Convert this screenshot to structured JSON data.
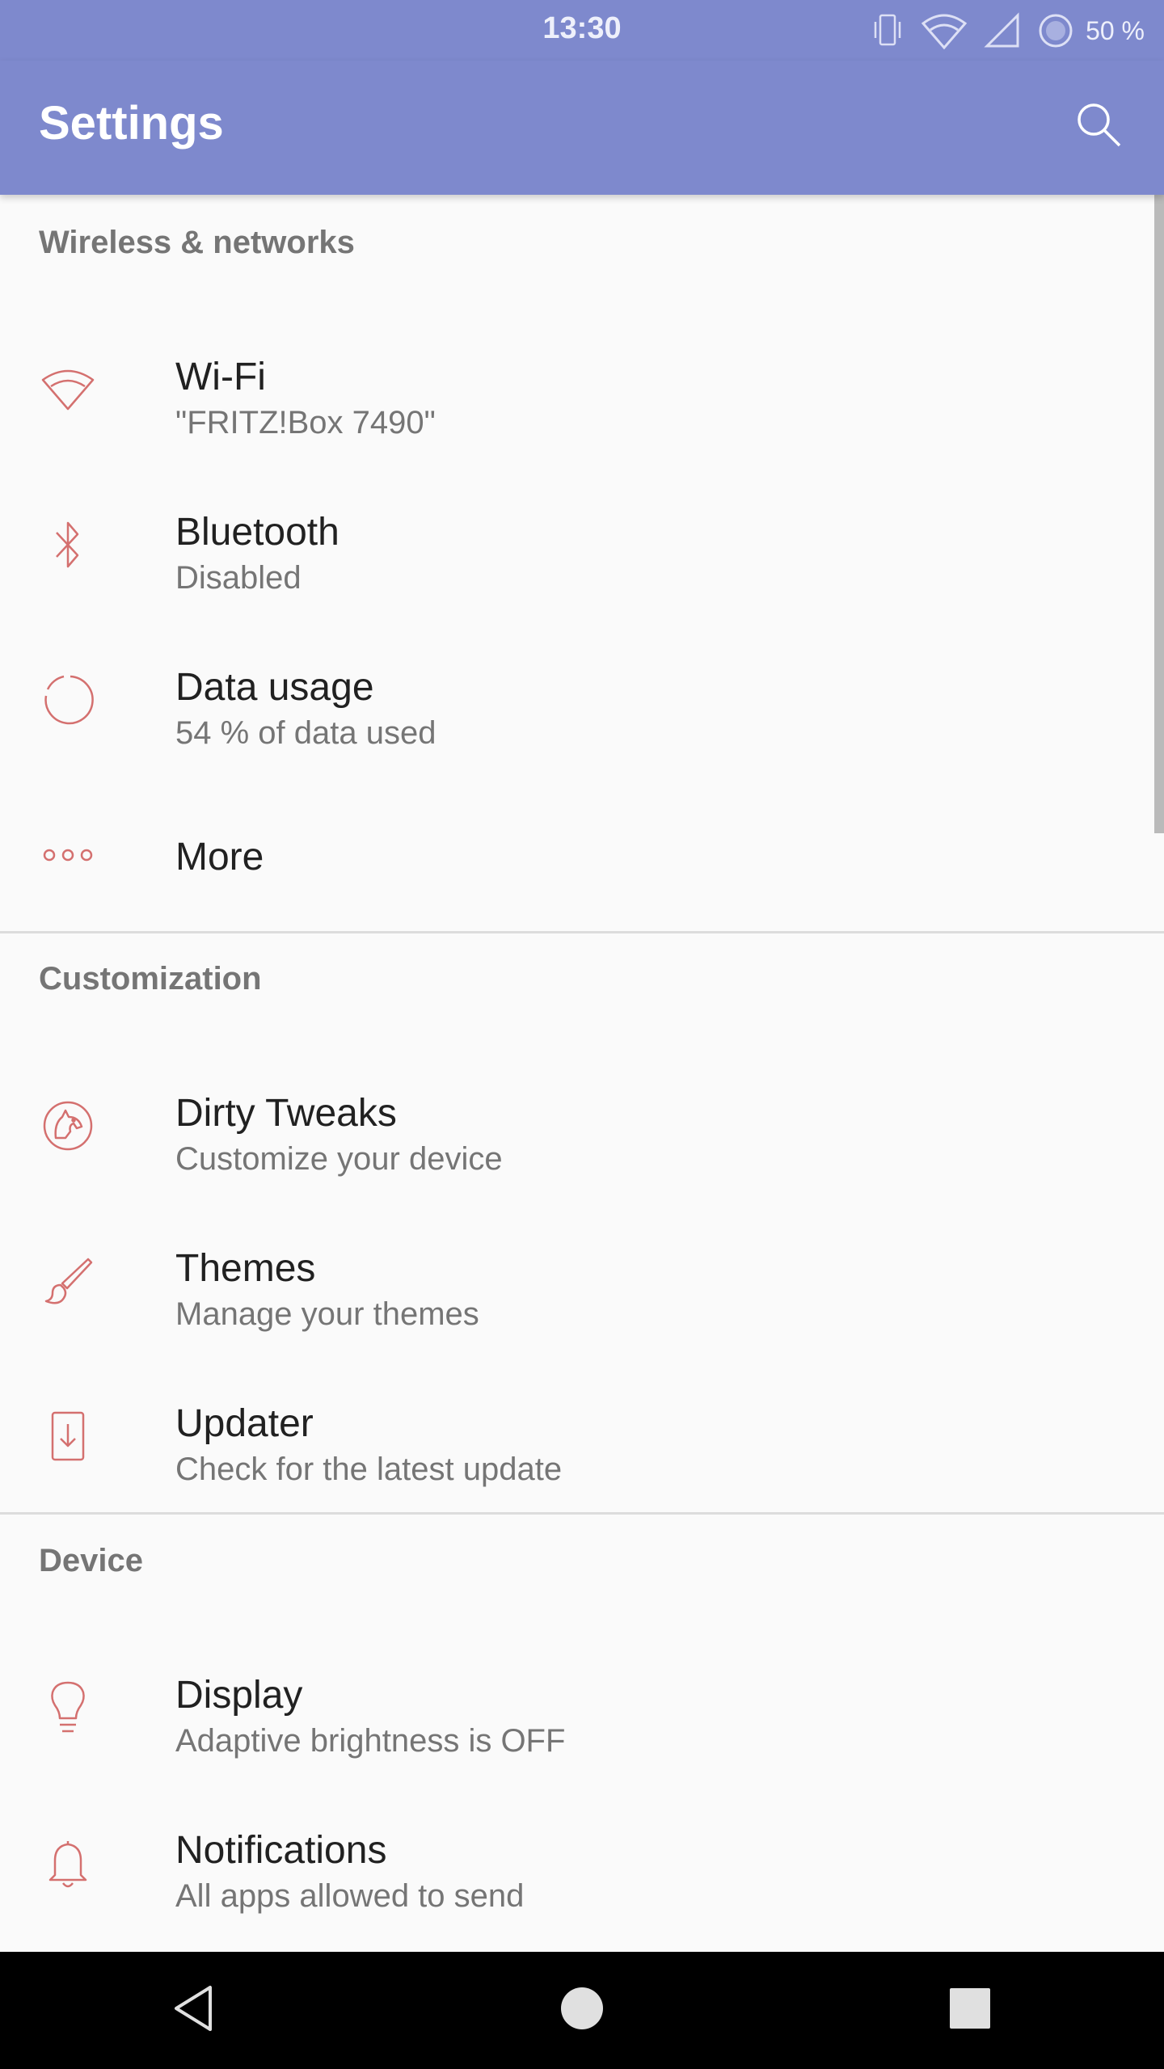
{
  "status_bar": {
    "time": "13:30",
    "battery_percent": "50 %",
    "icons": [
      "vibrate-icon",
      "wifi-icon",
      "cell-signal-icon",
      "battery-icon"
    ]
  },
  "app_bar": {
    "title": "Settings",
    "search_icon": "search-icon",
    "background_color": "#7e89cd"
  },
  "accent_color": "#d4706f",
  "sections": [
    {
      "header": "Wireless & networks",
      "items": [
        {
          "icon": "wifi-icon",
          "title": "Wi-Fi",
          "subtitle": "\"FRITZ!Box 7490\""
        },
        {
          "icon": "bluetooth-icon",
          "title": "Bluetooth",
          "subtitle": "Disabled"
        },
        {
          "icon": "data-usage-icon",
          "title": "Data usage",
          "subtitle": "54 % of data used"
        },
        {
          "icon": "more-icon",
          "title": "More",
          "subtitle": ""
        }
      ]
    },
    {
      "header": "Customization",
      "items": [
        {
          "icon": "dirty-tweaks-icon",
          "title": "Dirty Tweaks",
          "subtitle": "Customize your device"
        },
        {
          "icon": "brush-icon",
          "title": "Themes",
          "subtitle": "Manage your themes"
        },
        {
          "icon": "system-update-icon",
          "title": "Updater",
          "subtitle": "Check for the latest update"
        }
      ]
    },
    {
      "header": "Device",
      "items": [
        {
          "icon": "lightbulb-icon",
          "title": "Display",
          "subtitle": "Adaptive brightness is OFF"
        },
        {
          "icon": "bell-icon",
          "title": "Notifications",
          "subtitle": "All apps allowed to send"
        }
      ]
    }
  ],
  "nav_bar": {
    "buttons": [
      "back-icon",
      "home-icon",
      "recents-icon"
    ]
  }
}
